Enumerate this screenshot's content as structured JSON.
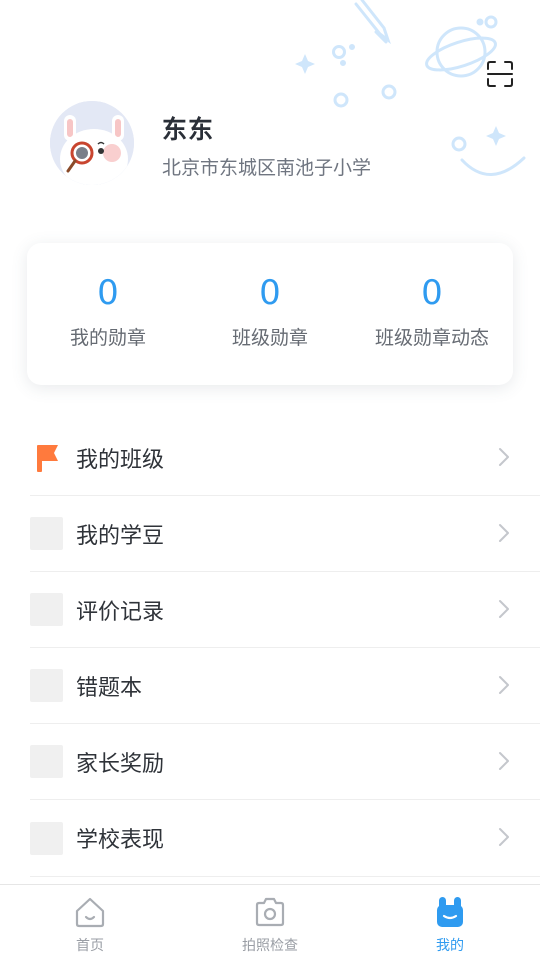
{
  "profile": {
    "name": "东东",
    "school": "北京市东城区南池子小学"
  },
  "stats": [
    {
      "value": "0",
      "label": "我的勋章"
    },
    {
      "value": "0",
      "label": "班级勋章"
    },
    {
      "value": "0",
      "label": "班级勋章动态"
    }
  ],
  "menu": {
    "items": [
      {
        "label": "我的班级",
        "icon": "flag-icon"
      },
      {
        "label": "我的学豆",
        "icon": "placeholder-icon"
      },
      {
        "label": "评价记录",
        "icon": "placeholder-icon"
      },
      {
        "label": "错题本",
        "icon": "placeholder-icon"
      },
      {
        "label": "家长奖励",
        "icon": "placeholder-icon"
      },
      {
        "label": "学校表现",
        "icon": "placeholder-icon"
      }
    ]
  },
  "nav": {
    "items": [
      {
        "label": "首页",
        "icon": "home-icon",
        "active": false
      },
      {
        "label": "拍照检查",
        "icon": "camera-icon",
        "active": false
      },
      {
        "label": "我的",
        "icon": "rabbit-icon",
        "active": true
      }
    ]
  },
  "colors": {
    "accent": "#2f9bf0",
    "flag": "#ff7a3d",
    "text_primary": "#2a2f38",
    "text_secondary": "#6f7580"
  }
}
